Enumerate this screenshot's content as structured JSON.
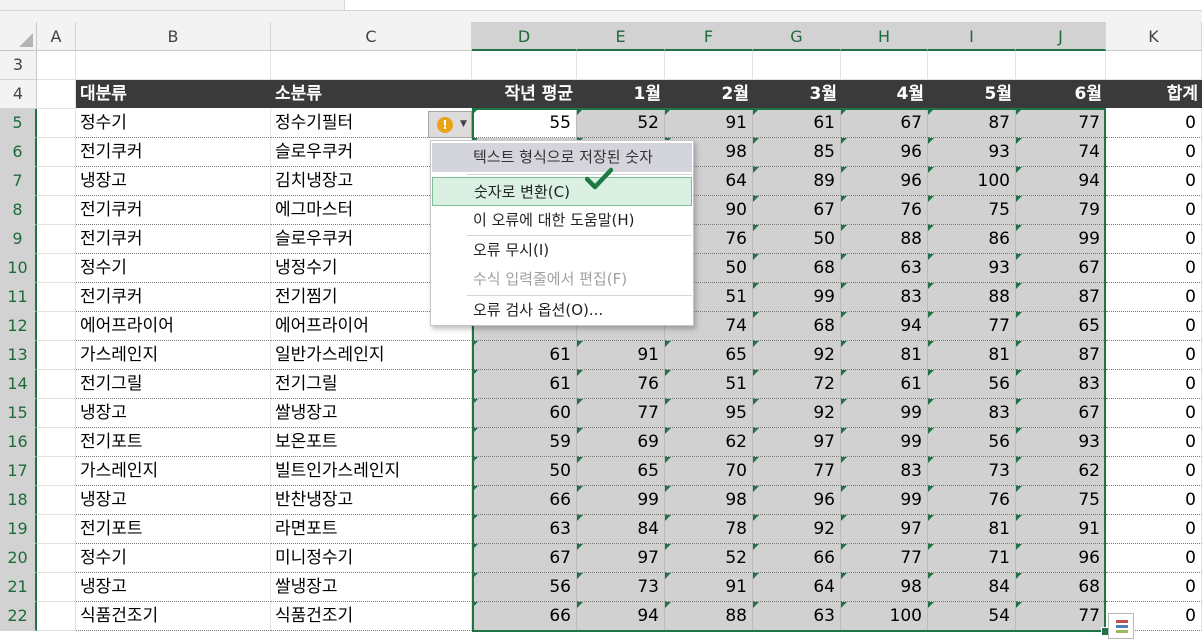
{
  "columns": [
    "A",
    "B",
    "C",
    "D",
    "E",
    "F",
    "G",
    "H",
    "I",
    "J",
    "K"
  ],
  "rows": [
    "3",
    "4",
    "5",
    "6",
    "7",
    "8",
    "9",
    "10",
    "11",
    "12",
    "13",
    "14",
    "15",
    "16",
    "17",
    "18",
    "19",
    "20",
    "21",
    "22"
  ],
  "headers": {
    "category": "대분류",
    "subcategory": "소분류",
    "last_year_avg": "작년 평균",
    "months": [
      "1월",
      "2월",
      "3월",
      "4월",
      "5월",
      "6월"
    ],
    "total": "합계"
  },
  "table": [
    {
      "cat": "정수기",
      "sub": "정수기필터",
      "avg": "55",
      "m": [
        "52",
        "91",
        "61",
        "67",
        "87",
        "77"
      ],
      "total": "0"
    },
    {
      "cat": "전기쿠커",
      "sub": "슬로우쿠커",
      "avg": "",
      "m": [
        "",
        "98",
        "85",
        "96",
        "93",
        "74"
      ],
      "total": "0"
    },
    {
      "cat": "냉장고",
      "sub": "김치냉장고",
      "avg": "",
      "m": [
        "",
        "64",
        "89",
        "96",
        "100",
        "94"
      ],
      "total": "0"
    },
    {
      "cat": "전기쿠커",
      "sub": "에그마스터",
      "avg": "",
      "m": [
        "",
        "90",
        "67",
        "76",
        "75",
        "79"
      ],
      "total": "0"
    },
    {
      "cat": "전기쿠커",
      "sub": "슬로우쿠커",
      "avg": "",
      "m": [
        "",
        "76",
        "50",
        "88",
        "86",
        "99"
      ],
      "total": "0"
    },
    {
      "cat": "정수기",
      "sub": "냉정수기",
      "avg": "",
      "m": [
        "",
        "50",
        "68",
        "63",
        "93",
        "67"
      ],
      "total": "0"
    },
    {
      "cat": "전기쿠커",
      "sub": "전기찜기",
      "avg": "",
      "m": [
        "",
        "51",
        "99",
        "83",
        "88",
        "87"
      ],
      "total": "0"
    },
    {
      "cat": "에어프라이어",
      "sub": "에어프라이어",
      "avg": "",
      "m": [
        "",
        "74",
        "68",
        "94",
        "77",
        "65"
      ],
      "total": "0"
    },
    {
      "cat": "가스레인지",
      "sub": "일반가스레인지",
      "avg": "61",
      "m": [
        "91",
        "65",
        "92",
        "81",
        "81",
        "87"
      ],
      "total": "0"
    },
    {
      "cat": "전기그릴",
      "sub": "전기그릴",
      "avg": "61",
      "m": [
        "76",
        "51",
        "72",
        "61",
        "56",
        "83"
      ],
      "total": "0"
    },
    {
      "cat": "냉장고",
      "sub": "쌀냉장고",
      "avg": "60",
      "m": [
        "77",
        "95",
        "92",
        "99",
        "83",
        "67"
      ],
      "total": "0"
    },
    {
      "cat": "전기포트",
      "sub": "보온포트",
      "avg": "59",
      "m": [
        "69",
        "62",
        "97",
        "99",
        "56",
        "93"
      ],
      "total": "0"
    },
    {
      "cat": "가스레인지",
      "sub": "빌트인가스레인지",
      "avg": "50",
      "m": [
        "65",
        "70",
        "77",
        "83",
        "73",
        "62"
      ],
      "total": "0"
    },
    {
      "cat": "냉장고",
      "sub": "반찬냉장고",
      "avg": "66",
      "m": [
        "99",
        "98",
        "96",
        "99",
        "76",
        "75"
      ],
      "total": "0"
    },
    {
      "cat": "전기포트",
      "sub": "라면포트",
      "avg": "63",
      "m": [
        "84",
        "78",
        "92",
        "97",
        "81",
        "91"
      ],
      "total": "0"
    },
    {
      "cat": "정수기",
      "sub": "미니정수기",
      "avg": "67",
      "m": [
        "97",
        "52",
        "66",
        "77",
        "71",
        "96"
      ],
      "total": "0"
    },
    {
      "cat": "냉장고",
      "sub": "쌀냉장고",
      "avg": "56",
      "m": [
        "73",
        "91",
        "64",
        "98",
        "84",
        "68"
      ],
      "total": "0"
    },
    {
      "cat": "식품건조기",
      "sub": "식품건조기",
      "avg": "66",
      "m": [
        "94",
        "88",
        "63",
        "100",
        "54",
        "77"
      ],
      "total": "0"
    }
  ],
  "error_menu": {
    "title": "텍스트 형식으로 저장된 숫자",
    "convert": "숫자로 변환(C)",
    "help": "이 오류에 대한 도움말(H)",
    "ignore": "오류 무시(I)",
    "edit": "수식 입력줄에서 편집(F)",
    "options": "오류 검사 옵션(O)..."
  },
  "colors": {
    "accent": "#217346",
    "header_bg": "#3a3a3a",
    "selection_bg": "#d1d1d1",
    "warning": "#e8a317"
  },
  "icons": {
    "warning": "warning-icon",
    "check": "checkmark-icon",
    "quick_analysis": "quick-analysis-icon"
  }
}
